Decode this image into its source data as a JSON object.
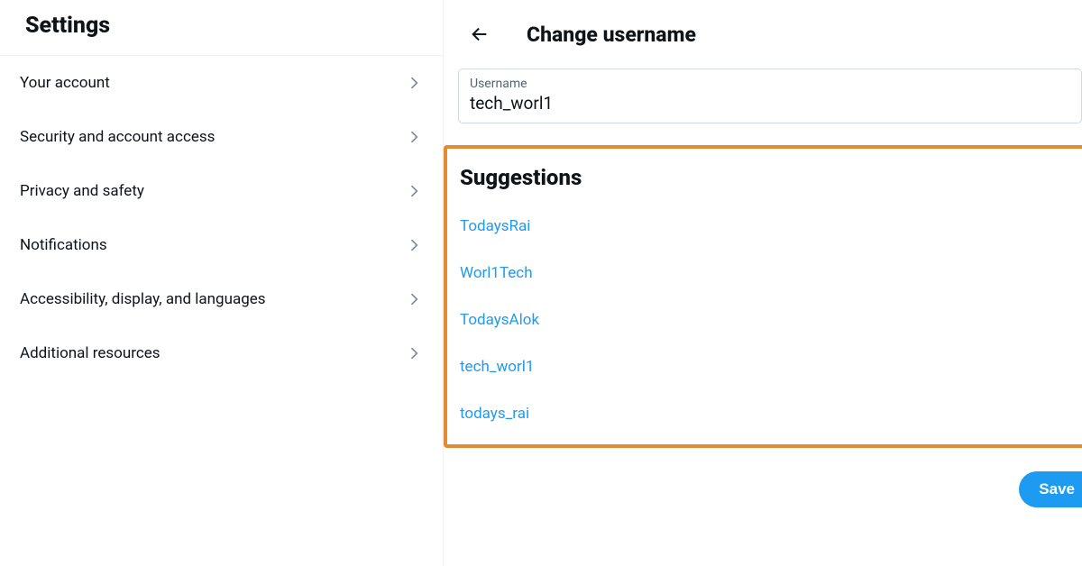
{
  "sidebar": {
    "title": "Settings",
    "items": [
      {
        "label": "Your account"
      },
      {
        "label": "Security and account access"
      },
      {
        "label": "Privacy and safety"
      },
      {
        "label": "Notifications"
      },
      {
        "label": "Accessibility, display, and languages"
      },
      {
        "label": "Additional resources"
      }
    ]
  },
  "main": {
    "title": "Change username",
    "field": {
      "label": "Username",
      "value": "tech_worl1"
    },
    "suggestions": {
      "title": "Suggestions",
      "items": [
        "TodaysRai",
        "Worl1Tech",
        "TodaysAlok",
        "tech_worl1",
        "todays_rai"
      ]
    },
    "save_label": "Save"
  },
  "colors": {
    "accent": "#1d9bf0",
    "highlight_border": "#e58a33"
  }
}
